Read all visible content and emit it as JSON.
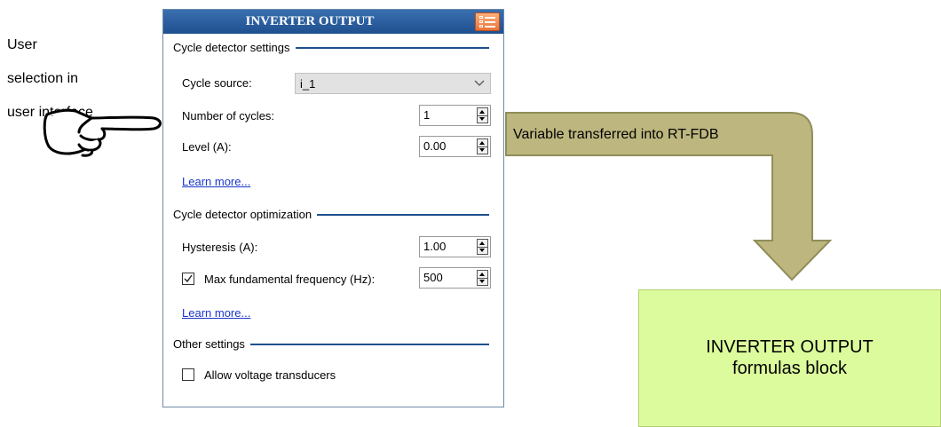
{
  "annotation": {
    "lines": [
      "User",
      "selection in",
      "user interface"
    ]
  },
  "panel": {
    "title": "INVERTER OUTPUT",
    "sections": {
      "cycle_detector_settings": "Cycle detector settings",
      "cycle_detector_optimization": "Cycle detector optimization",
      "other_settings": "Other settings"
    },
    "cycle_source": {
      "label": "Cycle source:",
      "value": "i_1"
    },
    "number_of_cycles": {
      "label": "Number of cycles:",
      "value": "1"
    },
    "level": {
      "label": "Level (A):",
      "value": "0.00"
    },
    "learn_more_1": "Learn more...",
    "hysteresis": {
      "label": "Hysteresis (A):",
      "value": "1.00"
    },
    "max_fundamental_frequency": {
      "label": "Max fundamental frequency (Hz):",
      "value": "500",
      "checked": true
    },
    "learn_more_2": "Learn more...",
    "allow_voltage_transducers": {
      "label": "Allow voltage transducers",
      "checked": false
    }
  },
  "flow": {
    "arrow_label": "Variable transferred into RT-FDB",
    "box_lines": [
      "INVERTER OUTPUT",
      "formulas block"
    ]
  },
  "colors": {
    "titlebar": "#2a5e9f",
    "section_line": "#1f4f8f",
    "link": "#1a35c9",
    "arrow_fill": "#bdb67f",
    "arrow_stroke": "#8f8e5a",
    "box_fill": "#dcfb9c"
  },
  "icons": [
    "pointing-hand-icon",
    "menu-list-icon",
    "chevron-down-icon",
    "spin-up-icon",
    "spin-down-icon",
    "checkmark-icon"
  ]
}
